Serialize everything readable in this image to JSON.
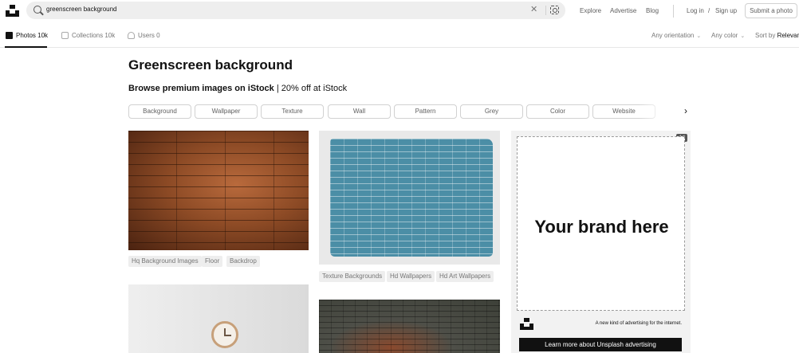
{
  "header": {
    "search": {
      "value": "greenscreen background"
    },
    "nav": {
      "explore": "Explore",
      "advertise": "Advertise",
      "blog": "Blog"
    },
    "auth": {
      "login": "Log in",
      "sep": "/",
      "signup": "Sign up"
    },
    "submit": "Submit a photo"
  },
  "filters": {
    "tabs": [
      {
        "label": "Photos 10k"
      },
      {
        "label": "Collections 10k"
      },
      {
        "label": "Users 0"
      }
    ],
    "orientation": "Any orientation",
    "color": "Any color",
    "sort_label": "Sort by",
    "sort_value": "Relevan"
  },
  "page": {
    "title": "Greenscreen background",
    "istock_bold": "Browse premium images on iStock",
    "istock_rest": " | 20% off at iStock"
  },
  "chips": [
    "Background",
    "Wallpaper",
    "Texture",
    "Wall",
    "Pattern",
    "Grey",
    "Color",
    "Website"
  ],
  "photos": {
    "p1_tags": [
      "Hq Background Images",
      "Floor",
      "Backdrop"
    ],
    "p2_tags": [
      "Texture Backgrounds",
      "Hd Wallpapers",
      "Hd Art Wallpapers"
    ]
  },
  "ad": {
    "badge": "Ad",
    "brand": "Your brand here",
    "tagline": "A new kind of advertising for the internet.",
    "cta": "Learn more about Unsplash advertising"
  }
}
